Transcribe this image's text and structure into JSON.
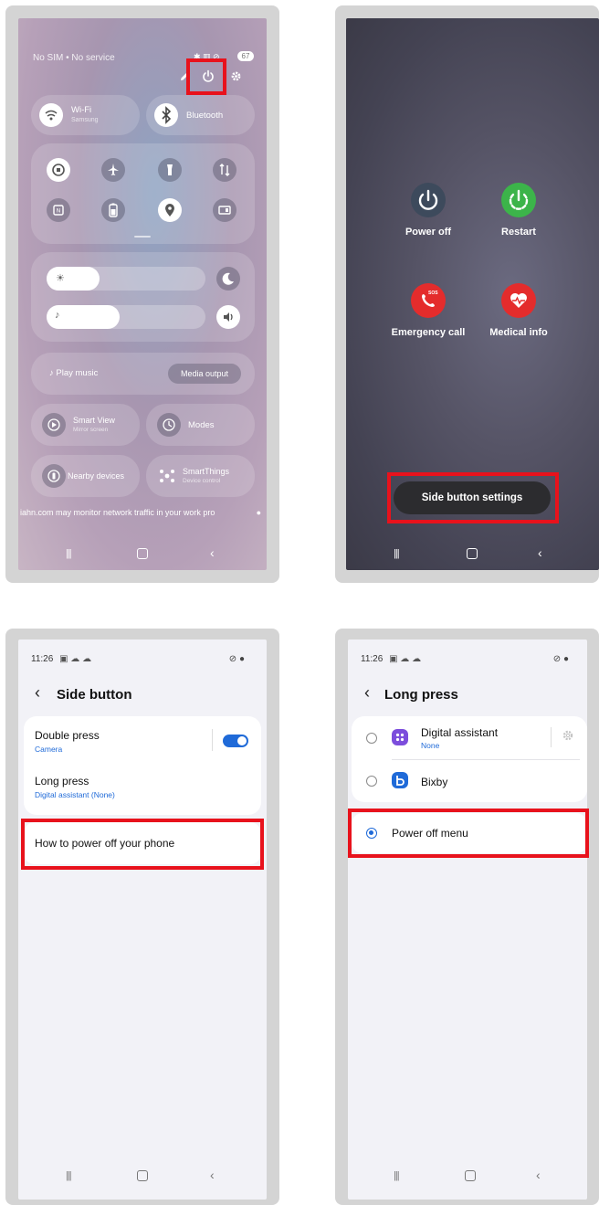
{
  "colors": {
    "highlight": "#e8121c",
    "accent": "#1f6ad8",
    "power_off": "#3d4a5c",
    "restart": "#3cb44a",
    "emergency": "#e42c2c",
    "medical": "#e42c2c"
  },
  "panel1": {
    "status_text": "No SIM • No service",
    "battery": "67",
    "icons": [
      "pencil-icon",
      "power-icon",
      "gear-icon"
    ],
    "wifi": {
      "label": "Wi-Fi",
      "network": "Samsung"
    },
    "bluetooth": {
      "label": "Bluetooth"
    },
    "toggles": [
      "auto-rotate-icon",
      "airplane-icon",
      "flashlight-icon",
      "data-transfer-icon",
      "nfc-icon",
      "battery-saver-icon",
      "location-icon",
      "cast-icon"
    ],
    "media": {
      "play_label": "Play music",
      "output_label": "Media output"
    },
    "smart_view": {
      "label": "Smart View",
      "sub": "Mirror screen"
    },
    "modes": {
      "label": "Modes"
    },
    "nearby": {
      "label": "Nearby devices"
    },
    "smartthings": {
      "label": "SmartThings",
      "sub": "Device control"
    },
    "notice": "iahn.com may monitor network traffic in your work pro"
  },
  "panel2": {
    "power_off": "Power off",
    "restart": "Restart",
    "emergency": "Emergency call",
    "emergency_badge": "SOS",
    "medical": "Medical info",
    "side_button_settings": "Side button settings"
  },
  "panel3": {
    "time": "11:26",
    "title": "Side button",
    "double_press": {
      "label": "Double press",
      "sub": "Camera",
      "enabled": true
    },
    "long_press": {
      "label": "Long press",
      "sub": "Digital assistant (None)"
    },
    "how_to": "How to power off your phone"
  },
  "panel4": {
    "time": "11:26",
    "title": "Long press",
    "options": [
      {
        "label": "Digital assistant",
        "sub": "None",
        "selected": false
      },
      {
        "label": "Bixby",
        "selected": false
      },
      {
        "label": "Power off menu",
        "selected": true
      }
    ]
  }
}
